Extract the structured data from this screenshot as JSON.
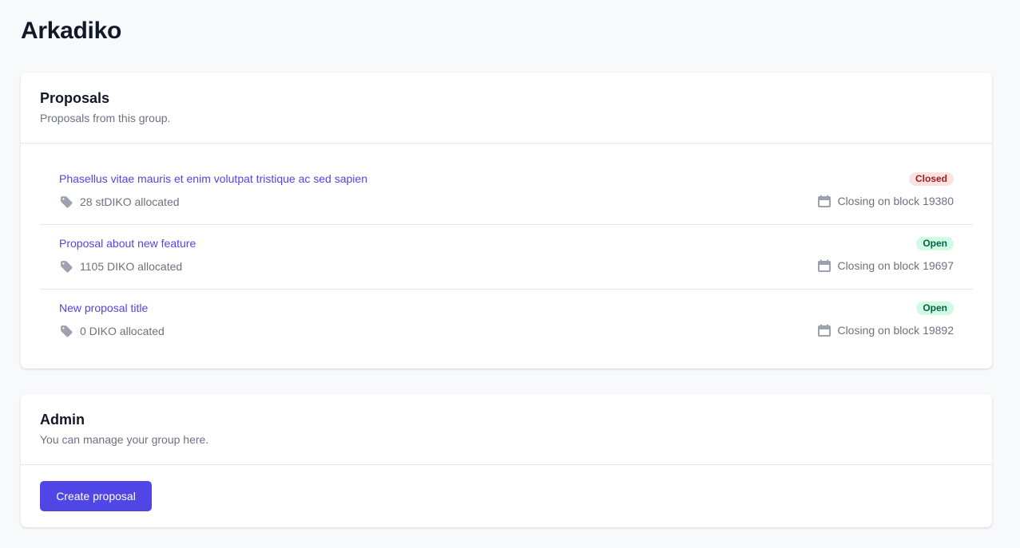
{
  "page": {
    "title": "Arkadiko"
  },
  "proposals": {
    "title": "Proposals",
    "description": "Proposals from this group.",
    "items": [
      {
        "title": "Phasellus vitae mauris et enim volutpat tristique ac sed sapien",
        "status": "Closed",
        "allocated": "28 stDIKO allocated",
        "closing": "Closing on block 19380"
      },
      {
        "title": "Proposal about new feature",
        "status": "Open",
        "allocated": "1105 DIKO allocated",
        "closing": "Closing on block 19697"
      },
      {
        "title": "New proposal title",
        "status": "Open",
        "allocated": "0 DIKO allocated",
        "closing": "Closing on block 19892"
      }
    ]
  },
  "admin": {
    "title": "Admin",
    "description": "You can manage your group here.",
    "create_button": "Create proposal"
  },
  "colors": {
    "accent": "#4f46e5",
    "closed_bg": "#fee2e2",
    "closed_text": "#991b1b",
    "open_bg": "#d1fae5",
    "open_text": "#065f46"
  },
  "icons": {
    "allocation": "tag-icon",
    "closing": "calendar-icon"
  }
}
